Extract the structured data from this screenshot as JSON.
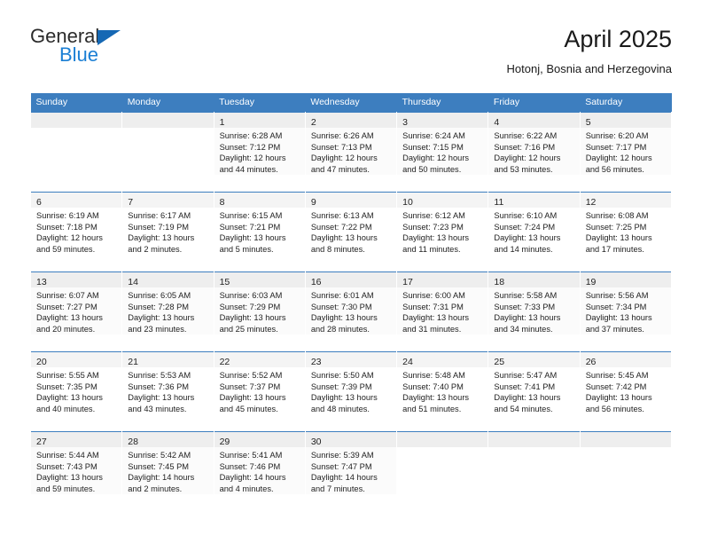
{
  "brand": {
    "name_part1": "General",
    "name_part2": "Blue",
    "triangle_icon": "blue-triangle-icon",
    "accent_color": "#1b7fd4"
  },
  "header": {
    "title": "April 2025",
    "subtitle": "Hotonj, Bosnia and Herzegovina",
    "header_bg_color": "#3d7ebf",
    "header_text_color": "#ffffff"
  },
  "calendar": {
    "weekday_headers": [
      "Sunday",
      "Monday",
      "Tuesday",
      "Wednesday",
      "Thursday",
      "Friday",
      "Saturday"
    ],
    "labels": {
      "sunrise_prefix": "Sunrise:",
      "sunset_prefix": "Sunset:",
      "daylight_prefix": "Daylight:"
    },
    "weeks": [
      [
        {
          "day": "",
          "empty": true
        },
        {
          "day": "",
          "empty": true
        },
        {
          "day": "1",
          "sunrise": "Sunrise: 6:28 AM",
          "sunset": "Sunset: 7:12 PM",
          "daylight_l1": "Daylight: 12 hours",
          "daylight_l2": "and 44 minutes."
        },
        {
          "day": "2",
          "sunrise": "Sunrise: 6:26 AM",
          "sunset": "Sunset: 7:13 PM",
          "daylight_l1": "Daylight: 12 hours",
          "daylight_l2": "and 47 minutes."
        },
        {
          "day": "3",
          "sunrise": "Sunrise: 6:24 AM",
          "sunset": "Sunset: 7:15 PM",
          "daylight_l1": "Daylight: 12 hours",
          "daylight_l2": "and 50 minutes."
        },
        {
          "day": "4",
          "sunrise": "Sunrise: 6:22 AM",
          "sunset": "Sunset: 7:16 PM",
          "daylight_l1": "Daylight: 12 hours",
          "daylight_l2": "and 53 minutes."
        },
        {
          "day": "5",
          "sunrise": "Sunrise: 6:20 AM",
          "sunset": "Sunset: 7:17 PM",
          "daylight_l1": "Daylight: 12 hours",
          "daylight_l2": "and 56 minutes."
        }
      ],
      [
        {
          "day": "6",
          "sunrise": "Sunrise: 6:19 AM",
          "sunset": "Sunset: 7:18 PM",
          "daylight_l1": "Daylight: 12 hours",
          "daylight_l2": "and 59 minutes."
        },
        {
          "day": "7",
          "sunrise": "Sunrise: 6:17 AM",
          "sunset": "Sunset: 7:19 PM",
          "daylight_l1": "Daylight: 13 hours",
          "daylight_l2": "and 2 minutes."
        },
        {
          "day": "8",
          "sunrise": "Sunrise: 6:15 AM",
          "sunset": "Sunset: 7:21 PM",
          "daylight_l1": "Daylight: 13 hours",
          "daylight_l2": "and 5 minutes."
        },
        {
          "day": "9",
          "sunrise": "Sunrise: 6:13 AM",
          "sunset": "Sunset: 7:22 PM",
          "daylight_l1": "Daylight: 13 hours",
          "daylight_l2": "and 8 minutes."
        },
        {
          "day": "10",
          "sunrise": "Sunrise: 6:12 AM",
          "sunset": "Sunset: 7:23 PM",
          "daylight_l1": "Daylight: 13 hours",
          "daylight_l2": "and 11 minutes."
        },
        {
          "day": "11",
          "sunrise": "Sunrise: 6:10 AM",
          "sunset": "Sunset: 7:24 PM",
          "daylight_l1": "Daylight: 13 hours",
          "daylight_l2": "and 14 minutes."
        },
        {
          "day": "12",
          "sunrise": "Sunrise: 6:08 AM",
          "sunset": "Sunset: 7:25 PM",
          "daylight_l1": "Daylight: 13 hours",
          "daylight_l2": "and 17 minutes."
        }
      ],
      [
        {
          "day": "13",
          "sunrise": "Sunrise: 6:07 AM",
          "sunset": "Sunset: 7:27 PM",
          "daylight_l1": "Daylight: 13 hours",
          "daylight_l2": "and 20 minutes."
        },
        {
          "day": "14",
          "sunrise": "Sunrise: 6:05 AM",
          "sunset": "Sunset: 7:28 PM",
          "daylight_l1": "Daylight: 13 hours",
          "daylight_l2": "and 23 minutes."
        },
        {
          "day": "15",
          "sunrise": "Sunrise: 6:03 AM",
          "sunset": "Sunset: 7:29 PM",
          "daylight_l1": "Daylight: 13 hours",
          "daylight_l2": "and 25 minutes."
        },
        {
          "day": "16",
          "sunrise": "Sunrise: 6:01 AM",
          "sunset": "Sunset: 7:30 PM",
          "daylight_l1": "Daylight: 13 hours",
          "daylight_l2": "and 28 minutes."
        },
        {
          "day": "17",
          "sunrise": "Sunrise: 6:00 AM",
          "sunset": "Sunset: 7:31 PM",
          "daylight_l1": "Daylight: 13 hours",
          "daylight_l2": "and 31 minutes."
        },
        {
          "day": "18",
          "sunrise": "Sunrise: 5:58 AM",
          "sunset": "Sunset: 7:33 PM",
          "daylight_l1": "Daylight: 13 hours",
          "daylight_l2": "and 34 minutes."
        },
        {
          "day": "19",
          "sunrise": "Sunrise: 5:56 AM",
          "sunset": "Sunset: 7:34 PM",
          "daylight_l1": "Daylight: 13 hours",
          "daylight_l2": "and 37 minutes."
        }
      ],
      [
        {
          "day": "20",
          "sunrise": "Sunrise: 5:55 AM",
          "sunset": "Sunset: 7:35 PM",
          "daylight_l1": "Daylight: 13 hours",
          "daylight_l2": "and 40 minutes."
        },
        {
          "day": "21",
          "sunrise": "Sunrise: 5:53 AM",
          "sunset": "Sunset: 7:36 PM",
          "daylight_l1": "Daylight: 13 hours",
          "daylight_l2": "and 43 minutes."
        },
        {
          "day": "22",
          "sunrise": "Sunrise: 5:52 AM",
          "sunset": "Sunset: 7:37 PM",
          "daylight_l1": "Daylight: 13 hours",
          "daylight_l2": "and 45 minutes."
        },
        {
          "day": "23",
          "sunrise": "Sunrise: 5:50 AM",
          "sunset": "Sunset: 7:39 PM",
          "daylight_l1": "Daylight: 13 hours",
          "daylight_l2": "and 48 minutes."
        },
        {
          "day": "24",
          "sunrise": "Sunrise: 5:48 AM",
          "sunset": "Sunset: 7:40 PM",
          "daylight_l1": "Daylight: 13 hours",
          "daylight_l2": "and 51 minutes."
        },
        {
          "day": "25",
          "sunrise": "Sunrise: 5:47 AM",
          "sunset": "Sunset: 7:41 PM",
          "daylight_l1": "Daylight: 13 hours",
          "daylight_l2": "and 54 minutes."
        },
        {
          "day": "26",
          "sunrise": "Sunrise: 5:45 AM",
          "sunset": "Sunset: 7:42 PM",
          "daylight_l1": "Daylight: 13 hours",
          "daylight_l2": "and 56 minutes."
        }
      ],
      [
        {
          "day": "27",
          "sunrise": "Sunrise: 5:44 AM",
          "sunset": "Sunset: 7:43 PM",
          "daylight_l1": "Daylight: 13 hours",
          "daylight_l2": "and 59 minutes."
        },
        {
          "day": "28",
          "sunrise": "Sunrise: 5:42 AM",
          "sunset": "Sunset: 7:45 PM",
          "daylight_l1": "Daylight: 14 hours",
          "daylight_l2": "and 2 minutes."
        },
        {
          "day": "29",
          "sunrise": "Sunrise: 5:41 AM",
          "sunset": "Sunset: 7:46 PM",
          "daylight_l1": "Daylight: 14 hours",
          "daylight_l2": "and 4 minutes."
        },
        {
          "day": "30",
          "sunrise": "Sunrise: 5:39 AM",
          "sunset": "Sunset: 7:47 PM",
          "daylight_l1": "Daylight: 14 hours",
          "daylight_l2": "and 7 minutes."
        },
        {
          "day": "",
          "empty": true
        },
        {
          "day": "",
          "empty": true
        },
        {
          "day": "",
          "empty": true
        }
      ]
    ]
  }
}
